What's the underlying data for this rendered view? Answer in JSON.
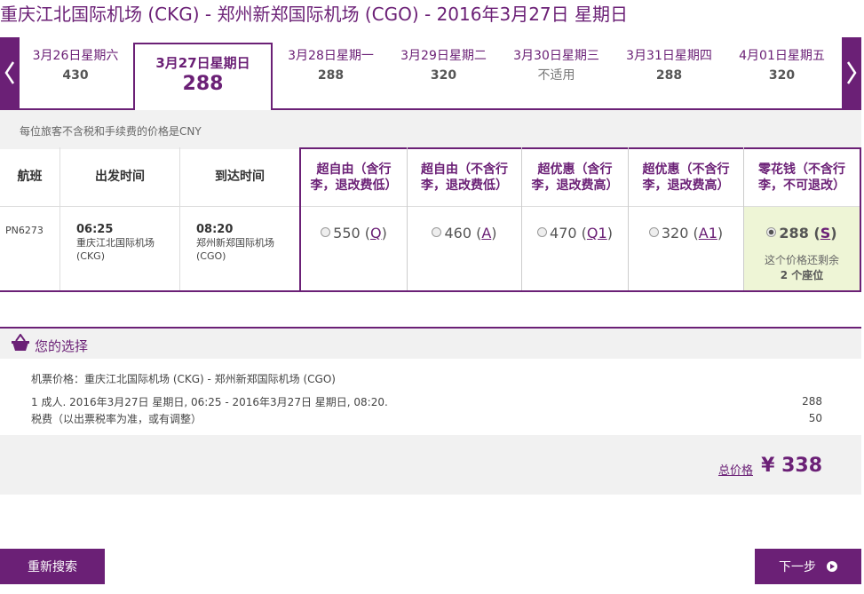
{
  "route_title": "重庆江北国际机场 (CKG) - 郑州新郑国际机场 (CGO) - 2016年3月27日 星期日",
  "date_tabs": [
    {
      "label": "3月26日星期六",
      "price": "430"
    },
    {
      "label": "3月27日星期日",
      "price": "288",
      "selected": true
    },
    {
      "label": "3月28日星期一",
      "price": "288"
    },
    {
      "label": "3月29日星期二",
      "price": "320"
    },
    {
      "label": "3月30日星期三",
      "price": "不适用"
    },
    {
      "label": "3月31日星期四",
      "price": "288"
    },
    {
      "label": "4月01日星期五",
      "price": "320"
    }
  ],
  "price_note": "每位旅客不含税和手续费的价格是CNY",
  "table": {
    "headers": {
      "flight": "航班",
      "depart": "出发时间",
      "arrive": "到达时间"
    },
    "fare_headers": [
      "超自由（含行李，退改费低）",
      "超自由（不含行李，退改费低）",
      "超优惠（含行李，退改费高）",
      "超优惠（不含行李，退改费高）",
      "零花钱（不含行李，不可退改）"
    ],
    "row": {
      "flight_no": "PN6273",
      "depart_time": "06:25",
      "depart_airport": "重庆江北国际机场",
      "depart_code": "(CKG)",
      "arrive_time": "08:20",
      "arrive_airport": "郑州新郑国际机场",
      "arrive_code": "(CGO)",
      "fares": [
        {
          "price": "550",
          "class": "Q"
        },
        {
          "price": "460",
          "class": "A"
        },
        {
          "price": "470",
          "class": "Q1"
        },
        {
          "price": "320",
          "class": "A1"
        },
        {
          "price": "288",
          "class": "S",
          "selected": true
        }
      ],
      "seats_note_1": "这个价格还剩余",
      "seats_note_2": "2 个座位"
    }
  },
  "selection": {
    "title": "您的选择",
    "ticket_line": "机票价格：重庆江北国际机场 (CKG) - 郑州新郑国际机场 (CGO)",
    "pax_line": "1 成人. 2016年3月27日 星期日, 06:25 - 2016年3月27日 星期日, 08:20.",
    "pax_amount": "288",
    "tax_line": "税费（以出票税率为准，或有调整）",
    "tax_amount": "50",
    "total_label": "总价格",
    "total_value": "¥ 338"
  },
  "buttons": {
    "research": "重新搜索",
    "next": "下一步"
  },
  "colors": {
    "brand": "#6b2076",
    "selected_fare_bg": "#eef5d6"
  }
}
